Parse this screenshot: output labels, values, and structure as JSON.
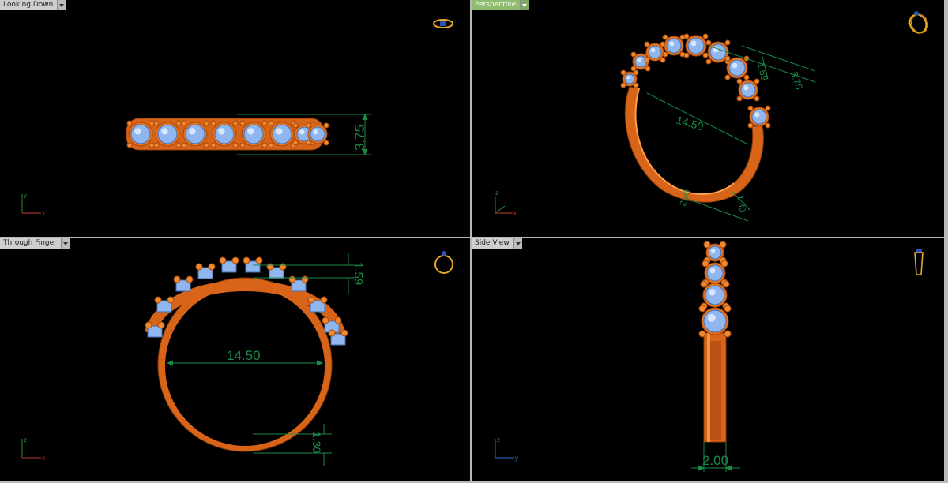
{
  "viewports": [
    {
      "title": "Looking Down",
      "active": false,
      "axes": {
        "horizontal": "x",
        "vertical": "y"
      },
      "dimensions": [
        "3.75"
      ],
      "icon": "ring-top-view-icon"
    },
    {
      "title": "Perspective",
      "active": true,
      "axes": {
        "horizontal": "x",
        "vertical": "z"
      },
      "dimensions": [
        "14.50",
        "1.59",
        "3.75",
        "1.30",
        "2.00"
      ],
      "icon": "ring-perspective-icon"
    },
    {
      "title": "Through Finger",
      "active": false,
      "axes": {
        "horizontal": "x",
        "vertical": "z"
      },
      "dimensions": [
        "14.50",
        "1.59",
        "1.30"
      ],
      "icon": "ring-front-view-icon"
    },
    {
      "title": "Side View",
      "active": false,
      "axes": {
        "horizontal": "y",
        "vertical": "z"
      },
      "dimensions": [
        "2.00"
      ],
      "icon": "ring-side-view-icon"
    }
  ],
  "colors": {
    "metal": "#e8741c",
    "metal_dark": "#a84608",
    "gem": "#8fb6ee",
    "dimension": "#1a8a48",
    "background": "#000000",
    "active_tab": "#8fbc6e"
  }
}
